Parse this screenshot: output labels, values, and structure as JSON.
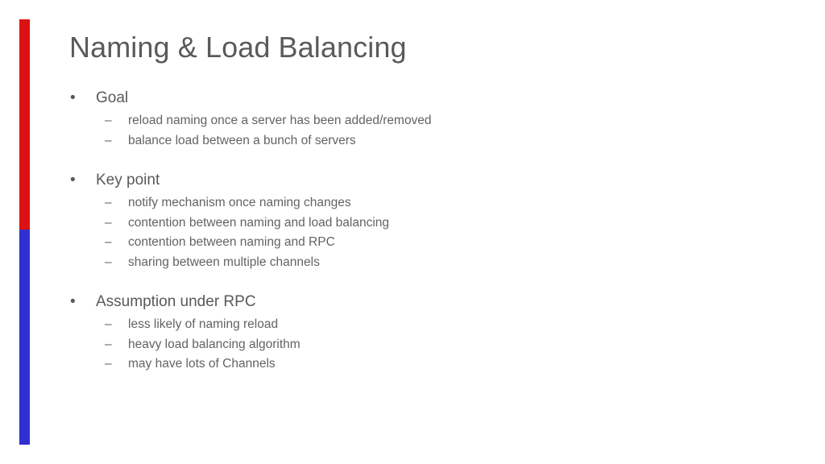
{
  "slide": {
    "title": "Naming & Load Balancing",
    "accent": {
      "top_color": "#DD1111",
      "bottom_color": "#3030D0"
    },
    "bullet_marker": "•",
    "sub_marker": "–",
    "groups": [
      {
        "heading": "Goal",
        "items": [
          "reload naming once a server has been added/removed",
          "balance load between a bunch of servers"
        ]
      },
      {
        "heading": "Key point",
        "items": [
          "notify mechanism once naming changes",
          "contention between naming and load balancing",
          "contention between naming and RPC",
          "sharing between multiple channels"
        ]
      },
      {
        "heading": "Assumption under RPC",
        "items": [
          "less likely of naming reload",
          "heavy load balancing algorithm",
          "may have lots of Channels"
        ]
      }
    ]
  }
}
